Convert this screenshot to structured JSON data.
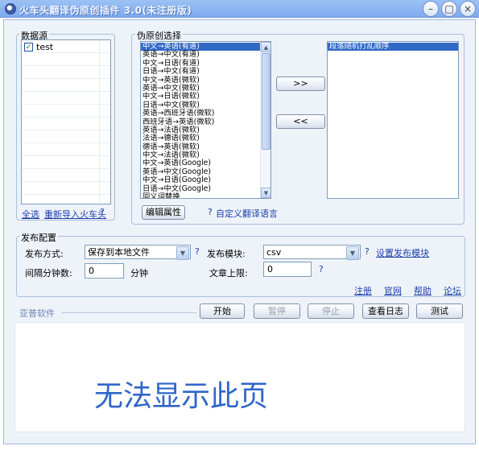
{
  "window": {
    "title": "火车头翻译伪原创插件 3.0(未注册版)",
    "minimize_glyph": "–",
    "maximize_glyph": "□",
    "close_glyph": "×"
  },
  "datasource": {
    "legend": "数据源",
    "items": [
      {
        "label": "test",
        "checked": true
      }
    ],
    "select_all": "全选",
    "reimport": "重新导入火车头",
    "help": "?"
  },
  "pseudo": {
    "legend": "伪原创选择",
    "options": [
      "中文→英语(有道)",
      "英语→中文(有道)",
      "中文→日语(有道)",
      "日语→中文(有道)",
      "中文→英语(微软)",
      "英语→中文(微软)",
      "中文→日语(微软)",
      "日语→中文(微软)",
      "英语→西班牙语(微软)",
      "西班牙语→英语(微软)",
      "英语→法语(微软)",
      "法语→德语(微软)",
      "德语→英语(微软)",
      "中文→法语(微软)",
      "中文→英语(Google)",
      "英语→中文(Google)",
      "中文→日语(Google)",
      "日语→中文(Google)",
      "同义词替换"
    ],
    "selected_index": 0,
    "add_button": ">>",
    "remove_button": "<<",
    "chosen": [
      "段落随机打乱顺序"
    ],
    "edit_button": "编辑属性",
    "help": "?",
    "custom_lang_link": "自定义翻译语言"
  },
  "publish": {
    "legend": "发布配置",
    "method_label": "发布方式:",
    "method_value": "保存到本地文件",
    "method_help": "?",
    "module_label": "发布模块:",
    "module_value": "csv",
    "module_help": "?",
    "module_link": "设置发布模块",
    "interval_label": "间隔分钟数:",
    "interval_value": "0",
    "interval_unit": "分钟",
    "limit_label": "文章上限:",
    "limit_value": "0",
    "limit_help": "?",
    "links": [
      "注册",
      "官网",
      "帮助",
      "论坛"
    ]
  },
  "bottom": {
    "brand": "亚普软件",
    "buttons": [
      "开始",
      "暂停",
      "停止",
      "查看日志",
      "测试"
    ],
    "disabled_buttons": [
      "暂停",
      "停止"
    ]
  },
  "browser": {
    "message": "无法显示此页"
  },
  "colors": {
    "title_bar": "#7eaaf0",
    "selection": "#3169c6",
    "link": "#1e3fa8",
    "message": "#2f66c9"
  }
}
